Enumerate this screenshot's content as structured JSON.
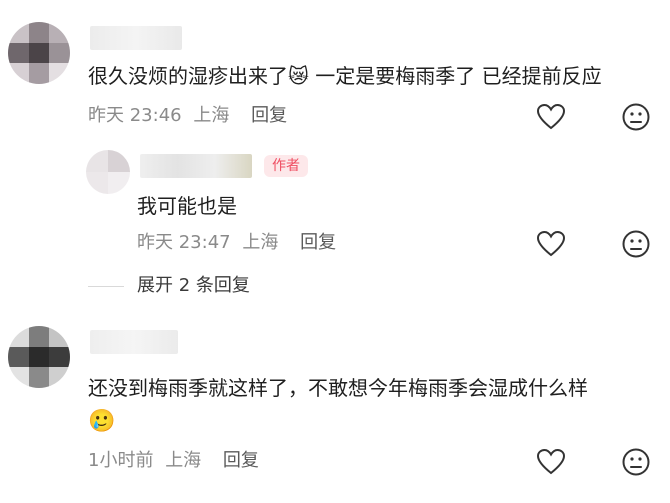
{
  "comments": [
    {
      "text_before_emoji": "很久没烦的湿疹出来了",
      "emoji": "😿",
      "text_after_emoji": " 一定是要梅雨季了 已经提前反应",
      "time": "昨天 23:46",
      "location": "上海",
      "reply_label": "回复",
      "actions": {
        "like_icon": "heart-outline",
        "dislike_icon": "sad-face"
      }
    },
    {
      "is_reply": true,
      "author_badge": "作者",
      "text": "我可能也是",
      "time": "昨天 23:47",
      "location": "上海",
      "reply_label": "回复",
      "actions": {
        "like_icon": "heart-outline",
        "dislike_icon": "sad-face"
      }
    },
    {
      "text": "还没到梅雨季就这样了，不敢想今年梅雨季会湿成什么样",
      "emoji": "🥲",
      "time": "1小时前",
      "location": "上海",
      "reply_label": "回复",
      "actions": {
        "like_icon": "heart-outline",
        "dislike_icon": "sad-face"
      }
    }
  ],
  "expand_replies": "展开 2 条回复"
}
